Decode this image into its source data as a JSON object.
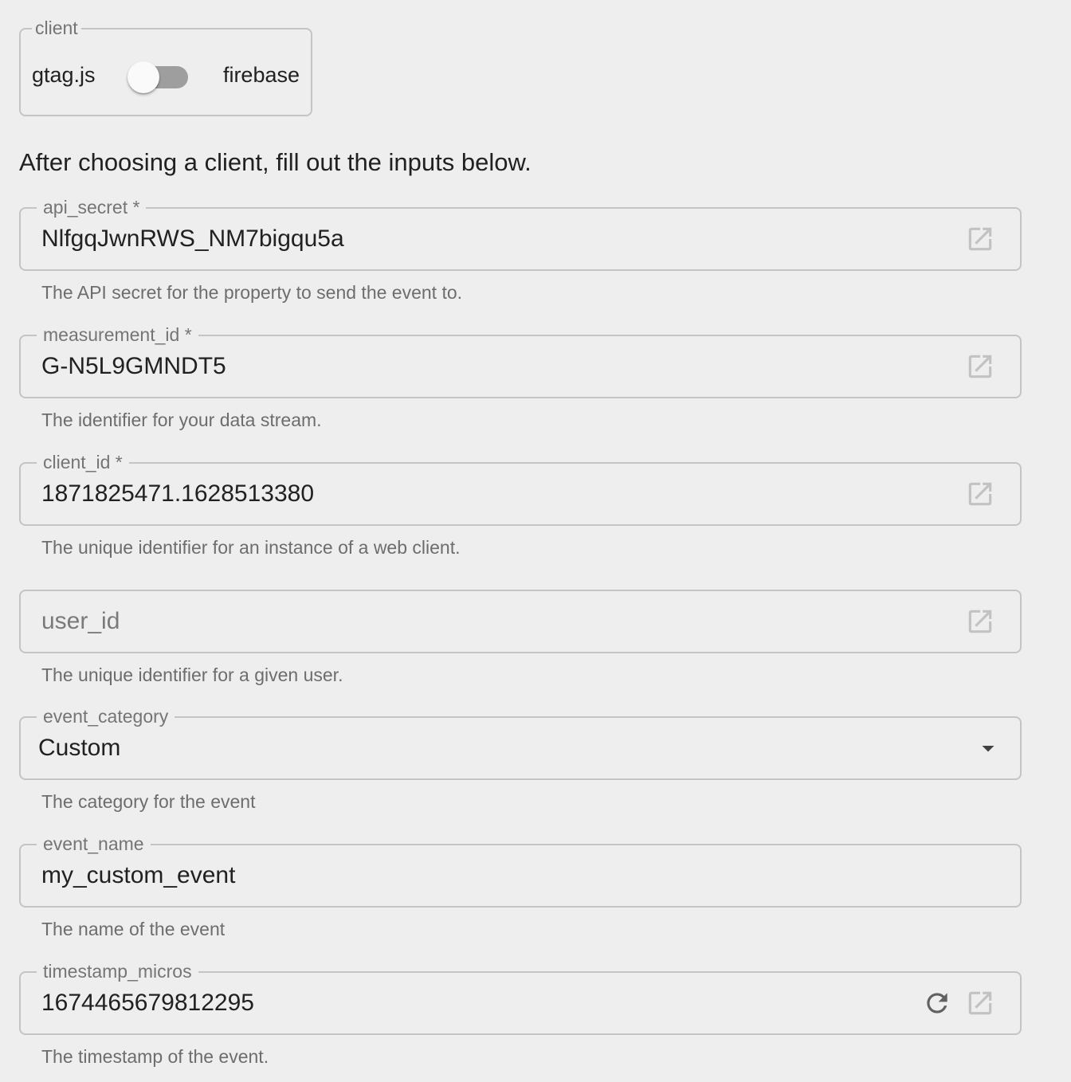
{
  "client": {
    "legend": "client",
    "option_left": "gtag.js",
    "option_right": "firebase"
  },
  "intro_text": "After choosing a client, fill out the inputs below.",
  "fields": {
    "api_secret": {
      "label": "api_secret *",
      "value": "NlfgqJwnRWS_NM7bigqu5a",
      "helper": "The API secret for the property to send the event to.",
      "icon": "open-in-new-icon"
    },
    "measurement_id": {
      "label": "measurement_id *",
      "value": "G-N5L9GMNDT5",
      "helper": "The identifier for your data stream.",
      "icon": "open-in-new-icon"
    },
    "client_id": {
      "label": "client_id *",
      "value": "1871825471.1628513380",
      "helper": "The unique identifier for an instance of a web client.",
      "icon": "open-in-new-icon"
    },
    "user_id": {
      "placeholder": "user_id",
      "helper": "The unique identifier for a given user.",
      "icon": "open-in-new-icon"
    },
    "event_category": {
      "label": "event_category",
      "value": "Custom",
      "helper": "The category for the event",
      "icon": "arrow-drop-down-icon"
    },
    "event_name": {
      "label": "event_name",
      "value": "my_custom_event",
      "helper": "The name of the event"
    },
    "timestamp_micros": {
      "label": "timestamp_micros",
      "value": "1674465679812295",
      "helper": "The timestamp of the event.",
      "icons": [
        "refresh-icon",
        "open-in-new-icon"
      ]
    }
  },
  "colors": {
    "background": "#eeeeee",
    "border": "#c4c4c4",
    "label": "#757575",
    "text": "#212121",
    "icon_disabled": "#c2c2c2",
    "icon_active": "#616161",
    "switch_track": "#9e9e9e",
    "switch_thumb": "#fafafa"
  }
}
